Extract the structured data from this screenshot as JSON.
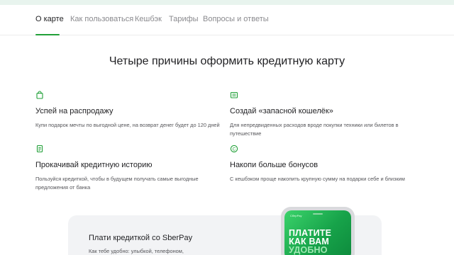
{
  "nav": {
    "tabs": [
      {
        "label": "О карте",
        "active": true
      },
      {
        "label": "Как пользоваться",
        "active": false
      },
      {
        "label": "Кешбэк",
        "active": false
      },
      {
        "label": "Тарифы",
        "active": false
      },
      {
        "label": "Вопросы и ответы",
        "active": false
      }
    ]
  },
  "main": {
    "heading": "Четыре причины оформить кредитную карту",
    "reasons": [
      {
        "icon": "shopping-bag-icon",
        "title": "Успей на распродажу",
        "desc": "Купи подарок мечты по выгодной цене, на возврат денег будет до 120 дней"
      },
      {
        "icon": "wallet-icon",
        "title": "Создай «запасной кошелёк»",
        "desc": "Для непредвиденных расходов вроде покупки техники или билетов в путешествие"
      },
      {
        "icon": "document-icon",
        "title": "Прокачивай кредитную историю",
        "desc": "Пользуйся кредиткой, чтобы в будущем получать самые выгодные предложения от банка"
      },
      {
        "icon": "cashback-coin-icon",
        "title": "Накопи больше бонусов",
        "desc": "С кешбэком проще накопить крупную сумму на подарки себе и близким"
      }
    ]
  },
  "promo": {
    "title": "Плати кредиткой со SberPay",
    "text": "Как тебе удобно: улыбкой, телефоном,",
    "phone": {
      "logo": "СберPay",
      "line1": "ПЛАТИТЕ",
      "line2": "КАК ВАМ",
      "line3": "УДОБНО"
    }
  },
  "colors": {
    "accent": "#21a038",
    "background": "#ffffff",
    "promo_bg": "#f2f3f5"
  }
}
